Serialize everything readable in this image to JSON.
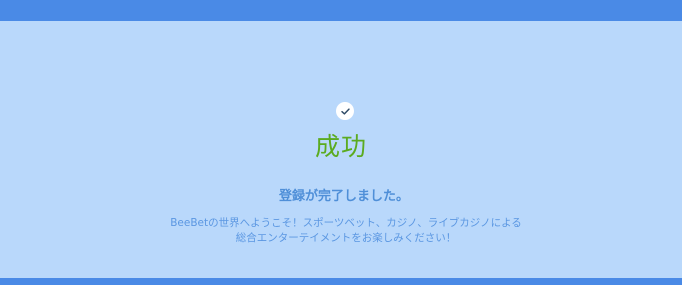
{
  "colors": {
    "background": "#b9d8fb",
    "bar": "#4a8ae6",
    "success": "#5bab20",
    "text_primary": "#4f8fd8",
    "text_secondary": "#5b97e2"
  },
  "status_icon": "check-circle-icon",
  "title": "成功",
  "message": "登録が完了しました。",
  "description": "BeeBetの世界へようこそ！スポーツベット、カジノ、ライブカジノによる総合エンターテイメントをお楽しみください！"
}
